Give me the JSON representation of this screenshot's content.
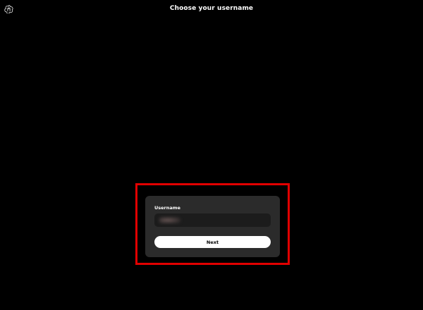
{
  "header": {
    "logo_icon": "openai-logo-icon",
    "title": "Choose your username"
  },
  "form": {
    "username_label": "Username",
    "username_value": "",
    "next_label": "Next"
  },
  "colors": {
    "background": "#000000",
    "card": "#2b2b2b",
    "input": "#1c1c1c",
    "button": "#ffffff",
    "highlight": "#e10000"
  }
}
